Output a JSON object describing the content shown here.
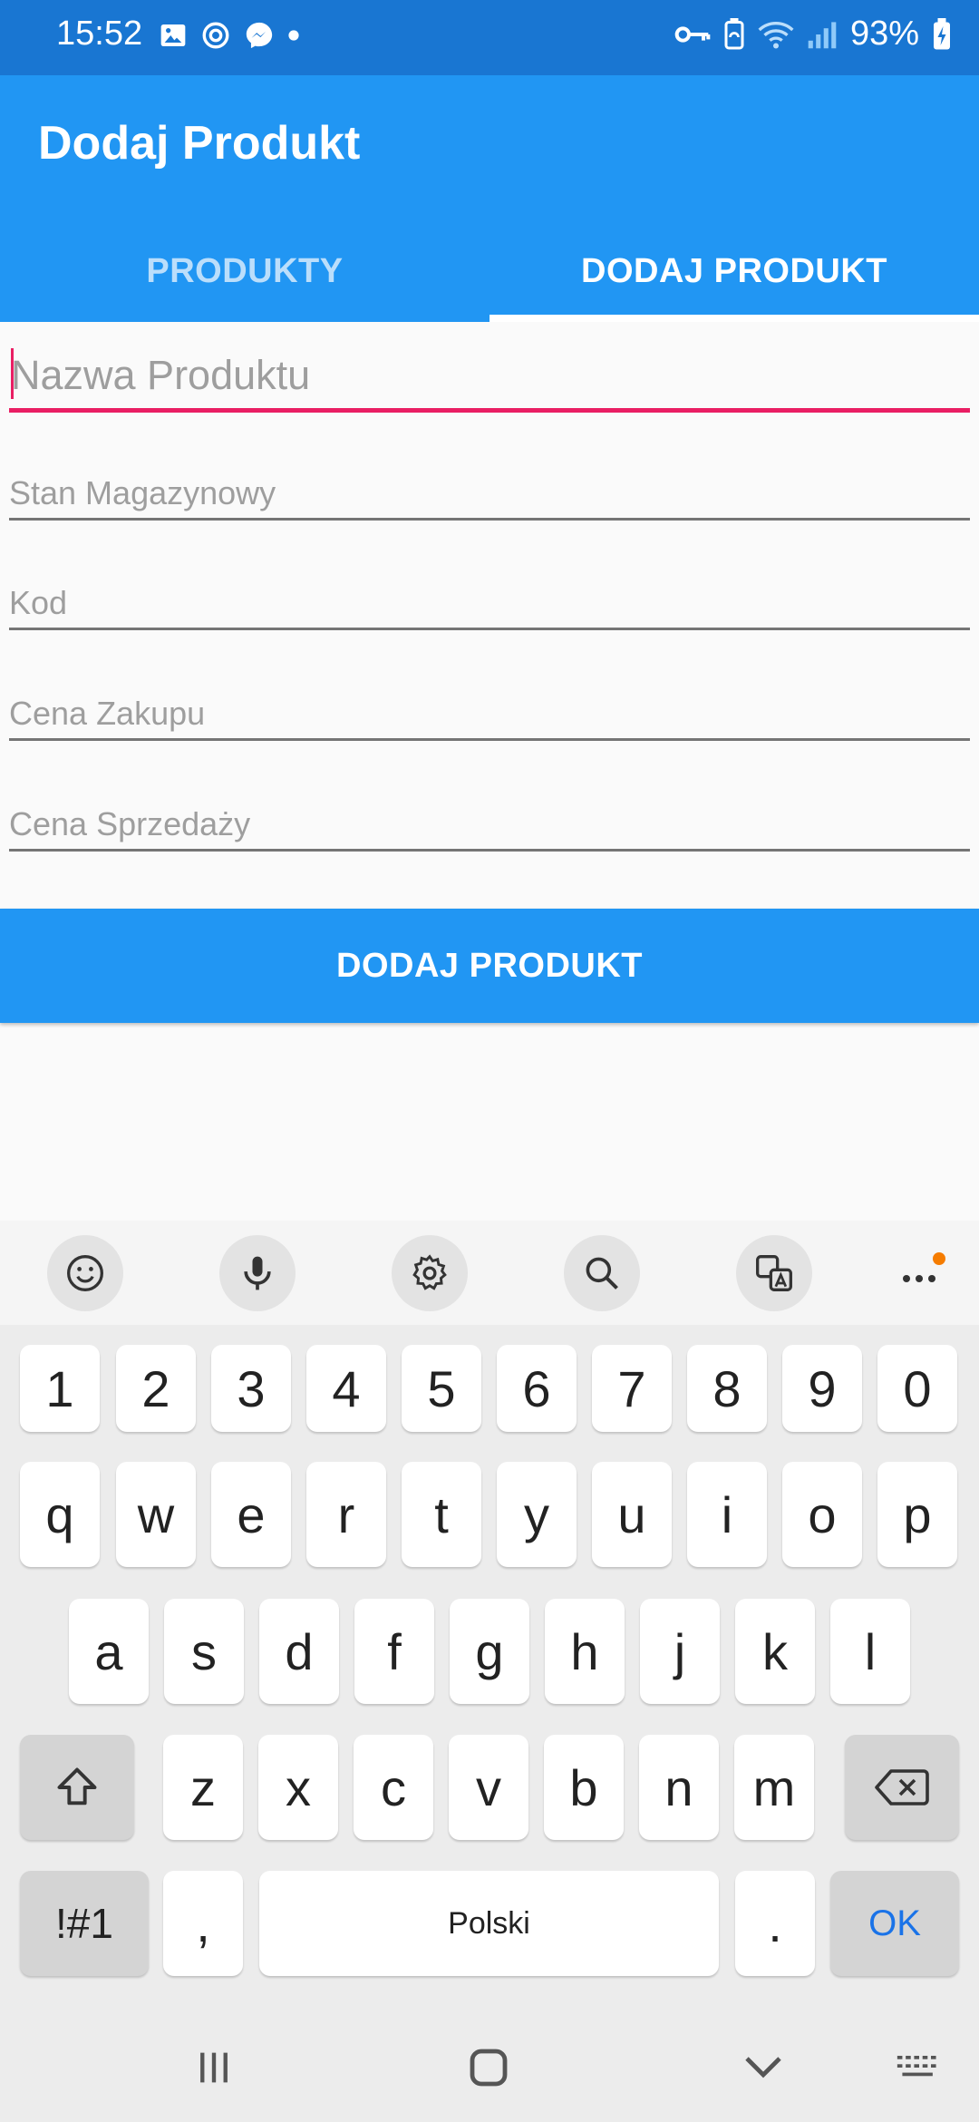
{
  "status_bar": {
    "time": "15:52",
    "battery": "93%",
    "left_icons": [
      "gallery-icon",
      "sync-icon",
      "messenger-icon",
      "dot-icon"
    ],
    "right_icons": [
      "vpn-key-icon",
      "battery-saver-icon",
      "wifi-icon",
      "signal-icon",
      "battery-charging-icon"
    ]
  },
  "app_bar": {
    "title": "Dodaj Produkt"
  },
  "tabs": [
    {
      "label": "PRODUKTY",
      "active": false
    },
    {
      "label": "DODAJ PRODUKT",
      "active": true
    }
  ],
  "form": {
    "fields": [
      {
        "placeholder": "Nazwa Produktu",
        "value": "",
        "focused": true
      },
      {
        "placeholder": "Stan Magazynowy",
        "value": ""
      },
      {
        "placeholder": "Kod",
        "value": ""
      },
      {
        "placeholder": "Cena Zakupu",
        "value": ""
      },
      {
        "placeholder": "Cena Sprzedaży",
        "value": ""
      }
    ],
    "submit_label": "DODAJ PRODUKT"
  },
  "keyboard": {
    "toolbar": [
      "emoji-icon",
      "microphone-icon",
      "settings-icon",
      "search-icon",
      "translate-icon",
      "more-icon"
    ],
    "numbers": [
      "1",
      "2",
      "3",
      "4",
      "5",
      "6",
      "7",
      "8",
      "9",
      "0"
    ],
    "row1": [
      "q",
      "w",
      "e",
      "r",
      "t",
      "y",
      "u",
      "i",
      "o",
      "p"
    ],
    "row2": [
      "a",
      "s",
      "d",
      "f",
      "g",
      "h",
      "j",
      "k",
      "l"
    ],
    "row3": [
      "z",
      "x",
      "c",
      "v",
      "b",
      "n",
      "m"
    ],
    "symbols_label": "!#1",
    "comma": ",",
    "space_label": "Polski",
    "period": ".",
    "ok_label": "OK"
  },
  "colors": {
    "status_bar": "#1976d2",
    "primary": "#2196f3",
    "accent": "#e91e63"
  }
}
